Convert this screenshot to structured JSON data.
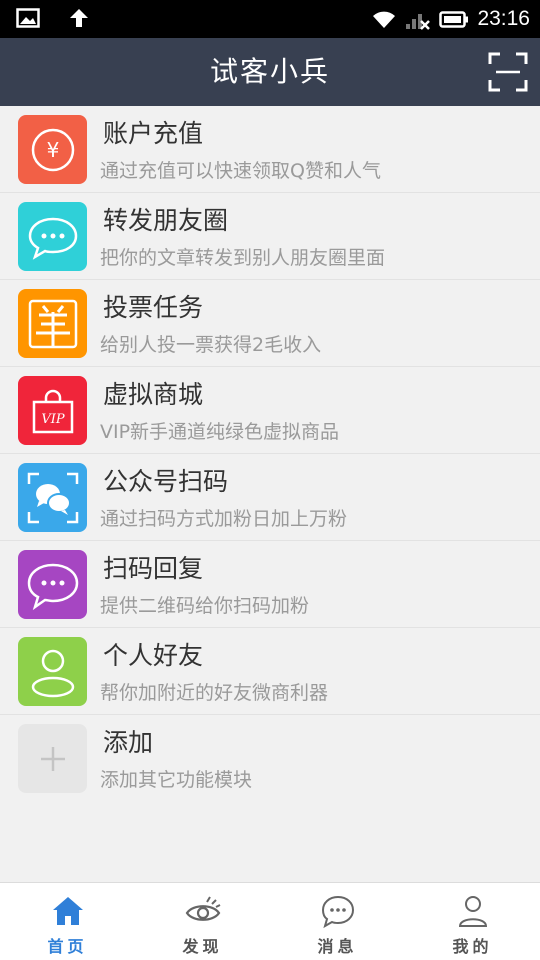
{
  "status": {
    "time": "23:16",
    "icons": [
      "image-icon",
      "upload-arrow-icon",
      "wifi-icon",
      "signal-icon",
      "battery-icon"
    ]
  },
  "header": {
    "title": "试客小兵",
    "scan_icon": "scan-icon"
  },
  "features": [
    {
      "title": "账户充值",
      "desc": "通过充值可以快速领取Q赞和人气",
      "color": "#f26046",
      "icon": "yuan-coin-icon"
    },
    {
      "title": "转发朋友圈",
      "desc": "把你的文章转发到别人朋友圈里面",
      "color": "#2fd0d8",
      "icon": "chat-bubble-icon"
    },
    {
      "title": "投票任务",
      "desc": "给别人投一票获得2毛收入",
      "color": "#ff9500",
      "icon": "yang-icon"
    },
    {
      "title": "虚拟商城",
      "desc": "VIP新手通道纯绿色虚拟商品",
      "color": "#f0253a",
      "icon": "vip-bag-icon",
      "icon_text": "VIP"
    },
    {
      "title": "公众号扫码",
      "desc": "通过扫码方式加粉日加上万粉",
      "color": "#3aa8ea",
      "icon": "scan-chat-icon"
    },
    {
      "title": "扫码回复",
      "desc": "提供二维码给你扫码加粉",
      "color": "#a646c2",
      "icon": "message-dots-icon"
    },
    {
      "title": "个人好友",
      "desc": "帮你加附近的好友微商利器",
      "color": "#8ed04a",
      "icon": "person-icon"
    },
    {
      "title": "添加",
      "desc": "添加其它功能模块",
      "color": "#e6e6e6",
      "icon": "plus-icon"
    }
  ],
  "tabs": [
    {
      "label": "首页",
      "icon": "home-icon",
      "active": true
    },
    {
      "label": "发现",
      "icon": "eye-icon",
      "active": false
    },
    {
      "label": "消息",
      "icon": "chat-icon",
      "active": false
    },
    {
      "label": "我的",
      "icon": "user-icon",
      "active": false
    }
  ],
  "colors": {
    "header_bg": "#384051",
    "accent": "#2f7fd8",
    "background": "#f1f1f1"
  }
}
